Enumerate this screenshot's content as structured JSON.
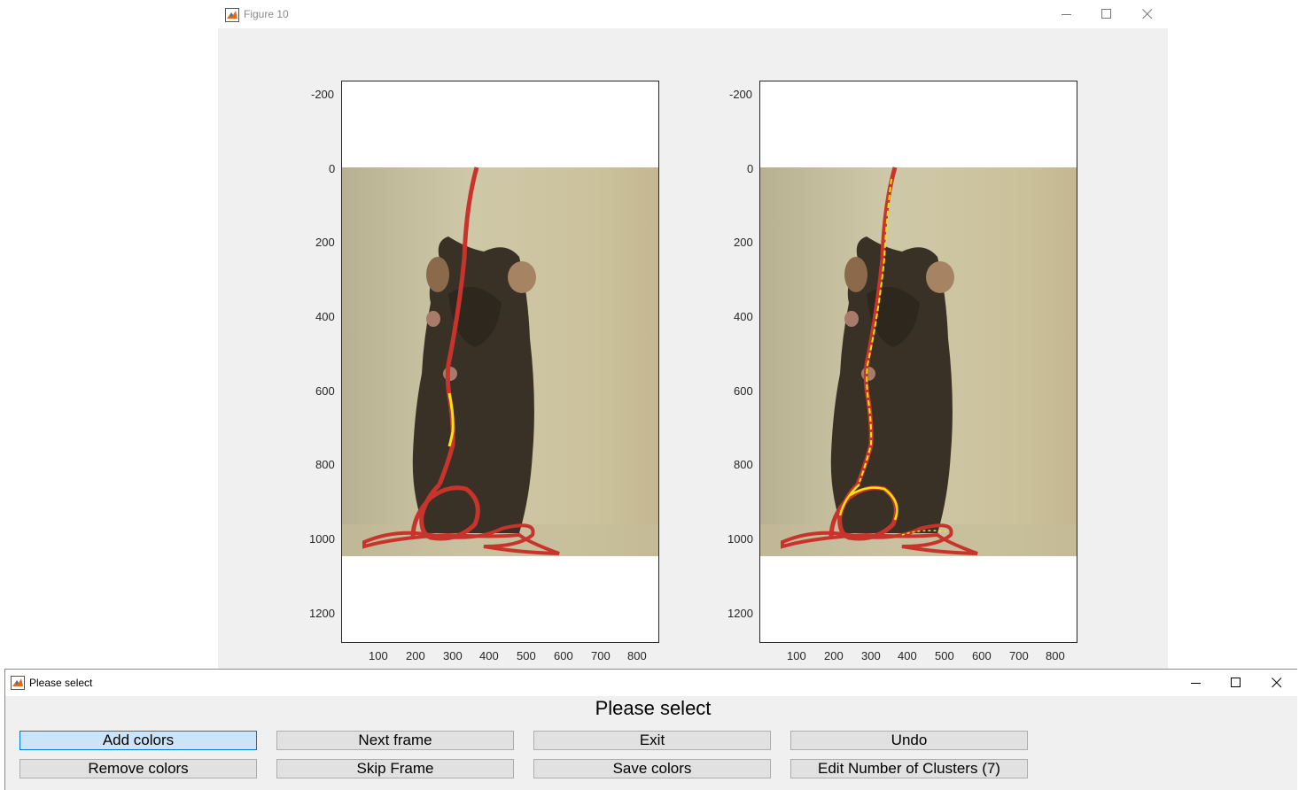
{
  "figure_window": {
    "title": "Figure 10",
    "controls": {
      "minimize_icon": "minimize-icon",
      "maximize_icon": "maximize-icon",
      "close_icon": "close-icon"
    },
    "axes": [
      {
        "name": "left",
        "y_ticks": [
          "-200",
          "0",
          "200",
          "400",
          "600",
          "800",
          "1000",
          "1200"
        ],
        "x_ticks": [
          "100",
          "200",
          "300",
          "400",
          "500",
          "600",
          "700",
          "800"
        ]
      },
      {
        "name": "right",
        "y_ticks": [
          "-200",
          "0",
          "200",
          "400",
          "600",
          "800",
          "1000",
          "1200"
        ],
        "x_ticks": [
          "100",
          "200",
          "300",
          "400",
          "500",
          "600",
          "700",
          "800"
        ]
      }
    ],
    "colors": {
      "background": "#f0f0f0",
      "string": "#c8342c",
      "highlight": "#f5e60c",
      "wall": "#cbc39f"
    }
  },
  "dialog_window": {
    "title": "Please select",
    "heading": "Please select",
    "buttons": {
      "add_colors": "Add colors",
      "next_frame": "Next frame",
      "exit": "Exit",
      "undo": "Undo",
      "remove_colors": "Remove colors",
      "skip_frame": "Skip Frame",
      "save_colors": "Save colors",
      "edit_clusters": "Edit Number of Clusters (7)"
    }
  }
}
